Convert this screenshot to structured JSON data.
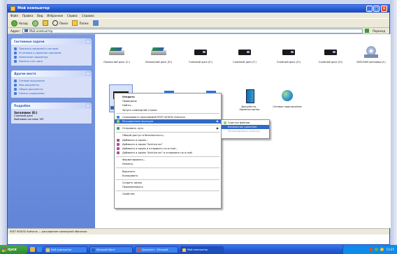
{
  "window": {
    "title": "Мой компьютер",
    "controls": {
      "minimize": "_",
      "maximize": "□",
      "close": "✕"
    }
  },
  "menu": [
    "Файл",
    "Правка",
    "Вид",
    "Избранное",
    "Сервис",
    "Справка"
  ],
  "toolbar": {
    "back": "Назад",
    "search": "Поиск",
    "folders": "Папки"
  },
  "address": {
    "label": "Адрес:",
    "value": "Мой компьютер",
    "go": "Переход"
  },
  "taskpane": {
    "system": {
      "title": "Системные задачи",
      "items": [
        "Просмотр сведений о системе",
        "Установка и удаление программ",
        "Изменение параметра",
        "Извлечь этот диск"
      ]
    },
    "places": {
      "title": "Другие места",
      "items": [
        "Сетевое окружение",
        "Мои документы",
        "Общие документы",
        "Панель управления"
      ]
    },
    "details": {
      "title": "Подробно",
      "name": "Заголовок (E:)",
      "type": "Съемный диск",
      "fs": "Файловая система: FAT"
    }
  },
  "drives": [
    {
      "label": "Локальный диск (C:)"
    },
    {
      "label": "Локальный диск (D:)"
    },
    {
      "label": "Съемный диск (E:)"
    },
    {
      "label": "Съемный диск (F:)"
    },
    {
      "label": "Съемный диск (G:)"
    },
    {
      "label": "Съемный диск (H:)"
    },
    {
      "label": "DVD-RAM дисковод (I:)"
    }
  ],
  "row2": [
    {
      "label": "Документы - Администратор"
    },
    {
      "label": "Сетевое подключение"
    }
  ],
  "context_menu": {
    "items": [
      "Открыть",
      "Проводник",
      "Найти...",
      "Запуск командной строки",
      "Сканировать программой ESET NOD32 Antivirus",
      "Расширенные функции",
      "Отправить путь",
      "Общий доступ и безопасность...",
      "Добавить в архив...",
      "Добавить в архив \"Archive.rar\"",
      "Добавить в архив и отправить по e-mail...",
      "Добавить в архив \"Archive.rar\" и отправить по e-mail",
      "Форматировать...",
      "Извлечь",
      "Вырезать",
      "Копировать",
      "Создать ярлык",
      "Переименовать",
      "Свойства"
    ],
    "submenu": [
      "Очистка файлов",
      "Безопасное удаление",
      "Запланировать очистку..."
    ]
  },
  "statusbar": "ESET NOD32 Antivirus — расширение командной оболочки",
  "taskbar": {
    "start": "пуск",
    "tasks": [
      "Мой компьютер",
      "Microsoft Word",
      "Документ - Microsoft",
      "Мой компьютер"
    ],
    "clock": "13:25"
  },
  "colors": {
    "titlebar": "#2359d4",
    "highlight": "#316ac5",
    "taskpane": "#6f8fde",
    "taskbar": "#245edb"
  }
}
